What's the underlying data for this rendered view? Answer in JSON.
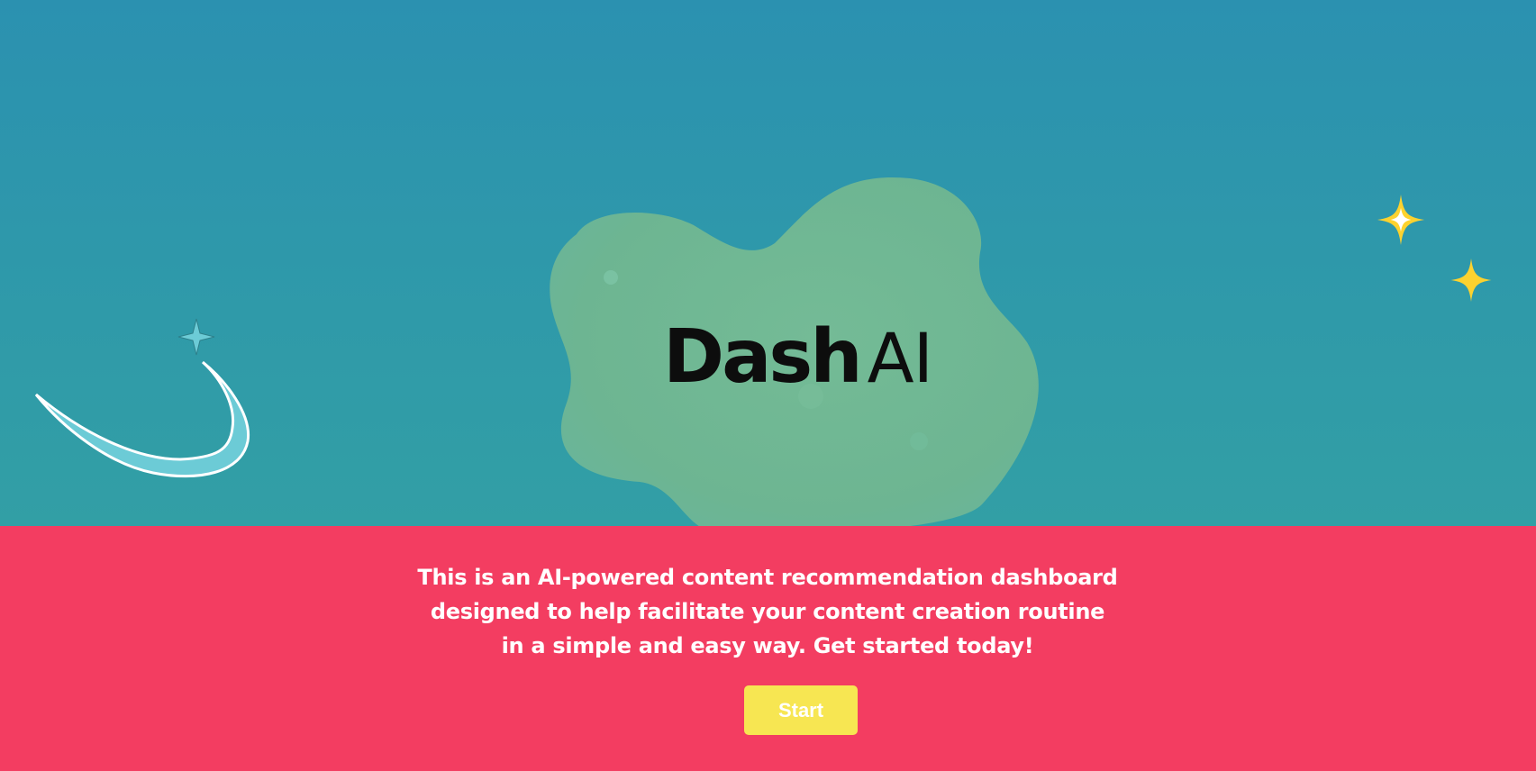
{
  "brand": {
    "logo_part1": "Dash",
    "logo_part2": "AI"
  },
  "hero": {
    "decorations": [
      "blob-shape",
      "swoosh-icon",
      "sparkle-icon"
    ]
  },
  "intro": {
    "lines": [
      "This is an AI-powered content recommendation dashboard",
      "designed to help facilitate your content creation routine",
      "in a simple and easy way. Get started today!"
    ]
  },
  "actions": {
    "start_label": "Start"
  },
  "colors": {
    "hero_background": "#2f96ad",
    "band_background": "#f33d61",
    "blob": "#6fb894",
    "button": "#f7e652",
    "sparkle_yellow": "#fcd22f",
    "sparkle_teal": "#6ccbd6"
  }
}
